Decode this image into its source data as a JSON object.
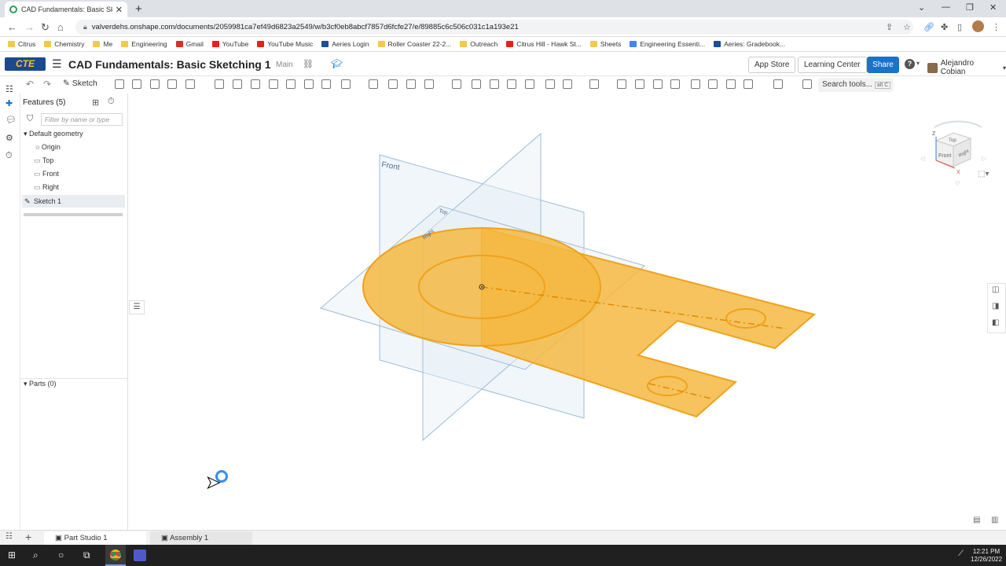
{
  "browser": {
    "tab_title": "CAD Fundamentals: Basic Sketch",
    "url": "valverdehs.onshape.com/documents/2059981ca7ef49d6823a2549/w/b3cf0eb8abcf7857d6fcfe27/e/89885c6c506c031c1a193e21",
    "bookmarks": [
      "Citrus",
      "Chemistry",
      "Me",
      "Engineering",
      "Gmail",
      "YouTube",
      "YouTube Music",
      "Aeries Login",
      "Roller Coaster 22-2...",
      "Outreach",
      "Citrus Hill - Hawk St...",
      "Sheets",
      "Engineering Essenti...",
      "Aeries: Gradebook..."
    ],
    "bookmark_colors": [
      "#f2c94c",
      "#f2c94c",
      "#f2c94c",
      "#f2c94c",
      "#d93025",
      "#e62117",
      "#e62117",
      "#1a4f9c",
      "#f2c94c",
      "#f2c94c",
      "#e62117",
      "#f2c94c",
      "#4285f4",
      "#1a4f9c"
    ]
  },
  "header": {
    "logo_text": "CTE",
    "doc_title": "CAD Fundamentals: Basic Sketching 1",
    "branch": "Main",
    "app_store": "App Store",
    "learning_center": "Learning Center",
    "share": "Share",
    "help": "?",
    "user_name": "Alejandro Cobian"
  },
  "toolbar": {
    "sketch_label": "Sketch",
    "search_label": "Search tools...",
    "search_shortcut": "alt C"
  },
  "features": {
    "title": "Features (5)",
    "filter_placeholder": "Filter by name or type",
    "group": "Default geometry",
    "items": [
      "Origin",
      "Top",
      "Front",
      "Right"
    ],
    "sketch": "Sketch 1",
    "parts": "Parts (0)"
  },
  "viewport": {
    "plane_front": "Front",
    "plane_top": "Top",
    "plane_right": "Right",
    "cube_top": "Top",
    "cube_front": "Front",
    "cube_right": "Right",
    "axis_z": "Z",
    "axis_x": "X",
    "sketch_color": "#f5b942",
    "sketch_stroke": "#f0a21c"
  },
  "bottom_tabs": {
    "part_studio": "Part Studio 1",
    "assembly": "Assembly 1"
  },
  "taskbar": {
    "time": "12:21 PM",
    "date": "12/26/2022"
  }
}
